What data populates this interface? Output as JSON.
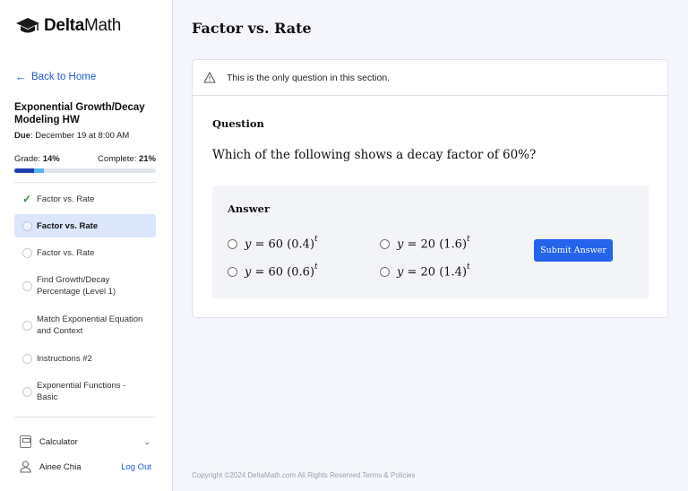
{
  "sidebar": {
    "logo_text_bold": "Delta",
    "logo_text_light": "Math",
    "back_label": "Back to Home",
    "assignment_title": "Exponential Growth/Decay Modeling HW",
    "due_label": "Due",
    "due_value": ": December 19 at 8:00 AM",
    "grade_label": "Grade: ",
    "grade_value": "14%",
    "complete_label": "Complete: ",
    "complete_value": "21%",
    "grade_fraction": 0.14,
    "complete_fraction": 0.21,
    "items": [
      {
        "label": "Factor vs. Rate",
        "status": "done"
      },
      {
        "label": "Factor vs. Rate",
        "status": "active"
      },
      {
        "label": "Factor vs. Rate",
        "status": "todo"
      },
      {
        "label": "Find Growth/Decay Percentage (Level 1)",
        "status": "todo"
      },
      {
        "label": "Match Exponential Equation and Context",
        "status": "todo"
      },
      {
        "label": "Instructions #2",
        "status": "todo"
      },
      {
        "label": "Exponential Functions - Basic",
        "status": "todo"
      }
    ],
    "calculator_label": "Calculator",
    "user_name": "Ainee Chia",
    "logout_label": "Log Out"
  },
  "main": {
    "page_title": "Factor vs. Rate",
    "notice": "This is the only question in this section.",
    "question_label": "Question",
    "question_text": "Which of the following shows a decay factor of 60%?",
    "answer_label": "Answer",
    "options": [
      {
        "lhs": "y",
        "eq": " = 60 ",
        "base": "(0.4)",
        "exp": "t"
      },
      {
        "lhs": "y",
        "eq": " = 20 ",
        "base": "(1.6)",
        "exp": "t"
      },
      {
        "lhs": "y",
        "eq": " = 60 ",
        "base": "(0.6)",
        "exp": "t"
      },
      {
        "lhs": "y",
        "eq": " = 20 ",
        "base": "(1.4)",
        "exp": "t"
      }
    ],
    "submit_label": "Submit Answer",
    "footer": "Copyright ©2024 DeltaMath.com All Rights Reserved.Terms & Policies"
  },
  "colors": {
    "accent": "#2563eb",
    "link": "#1f5bd8",
    "active_item_bg": "#dbe6fb",
    "check": "#2e8b3a",
    "grade_bar": "#1f3fb0",
    "complete_bar": "#5ab0f0"
  },
  "icons": [
    "graduation-cap-icon",
    "arrow-left-icon",
    "check-icon",
    "warning-triangle-icon",
    "calculator-icon",
    "chevron-down-icon",
    "user-icon"
  ]
}
